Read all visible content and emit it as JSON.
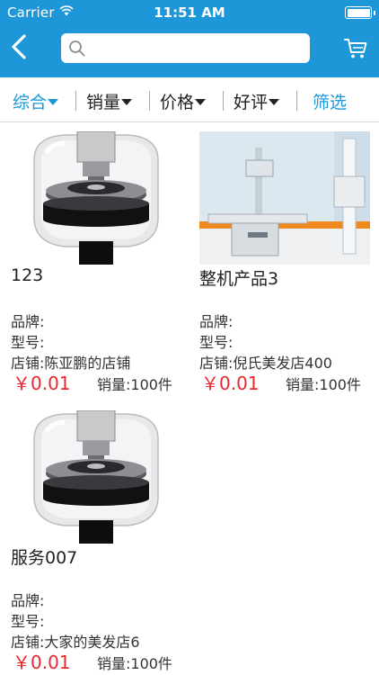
{
  "status_bar": {
    "carrier": "Carrier",
    "time": "11:51 AM"
  },
  "header": {
    "search_placeholder": "",
    "back_icon": "chevron-left-icon",
    "cart_icon": "cart-icon",
    "color": "#1e97d8"
  },
  "filters": {
    "items": [
      {
        "label": "综合",
        "active": true
      },
      {
        "label": "销量",
        "active": false
      },
      {
        "label": "价格",
        "active": false
      },
      {
        "label": "好评",
        "active": false
      }
    ],
    "screen_label": "筛选"
  },
  "products": [
    {
      "name": "123",
      "brand": "品牌:",
      "model": "型号:",
      "shop": "店铺:陈亚鹏的店铺",
      "price": "￥0.01",
      "sales": "销量:100件"
    },
    {
      "name": "整机产品3",
      "brand": "品牌:",
      "model": "型号:",
      "shop": "店铺:倪氏美发店400",
      "price": "￥0.01",
      "sales": "销量:100件"
    },
    {
      "name": "服务007",
      "brand": "品牌:",
      "model": "型号:",
      "shop": "店铺:大家的美发店6",
      "price": "￥0.01",
      "sales": "销量:100件"
    }
  ],
  "colors": {
    "accent": "#1e97d8",
    "price": "#e8282d"
  }
}
